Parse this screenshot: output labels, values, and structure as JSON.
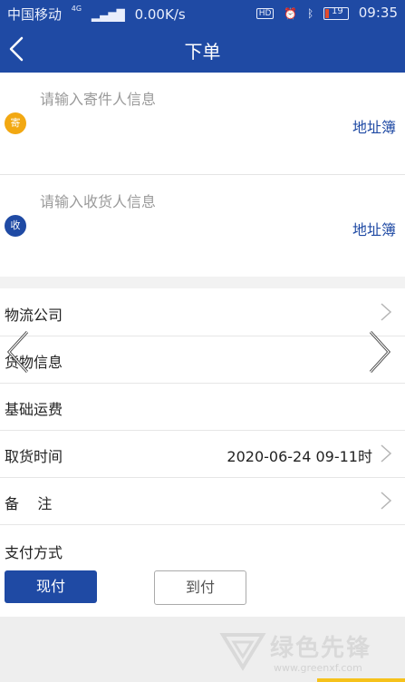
{
  "status_bar": {
    "carrier": "中国移动",
    "network": "4G",
    "speed": "0.00K/s",
    "hd_badge": "HD",
    "battery": "19",
    "time": "09:35",
    "icons": [
      "signal-icon",
      "alarm-icon",
      "bluetooth-icon",
      "battery-icon"
    ]
  },
  "header": {
    "title": "下单",
    "back_icon": "chevron-left-icon"
  },
  "sender": {
    "badge": "寄",
    "placeholder": "请输入寄件人信息",
    "address_book": "地址簿",
    "badge_color": "#f2a812"
  },
  "receiver": {
    "badge": "收",
    "placeholder": "请输入收货人信息",
    "address_book": "地址簿",
    "badge_color": "#1f4aa4"
  },
  "form": {
    "logistics_company": "物流公司",
    "goods_info": "货物信息",
    "base_freight": "基础运费",
    "pickup_time_label": "取货时间",
    "pickup_time_value": "2020-06-24 09-11时",
    "remarks": "备    注"
  },
  "payment": {
    "label": "支付方式",
    "options": [
      "现付",
      "到付"
    ],
    "selected": "现付"
  },
  "watermark": {
    "text": "绿色先锋",
    "url": "www.greenxf.com"
  },
  "colors": {
    "primary": "#1f4aa4",
    "accent": "#f2a812"
  }
}
